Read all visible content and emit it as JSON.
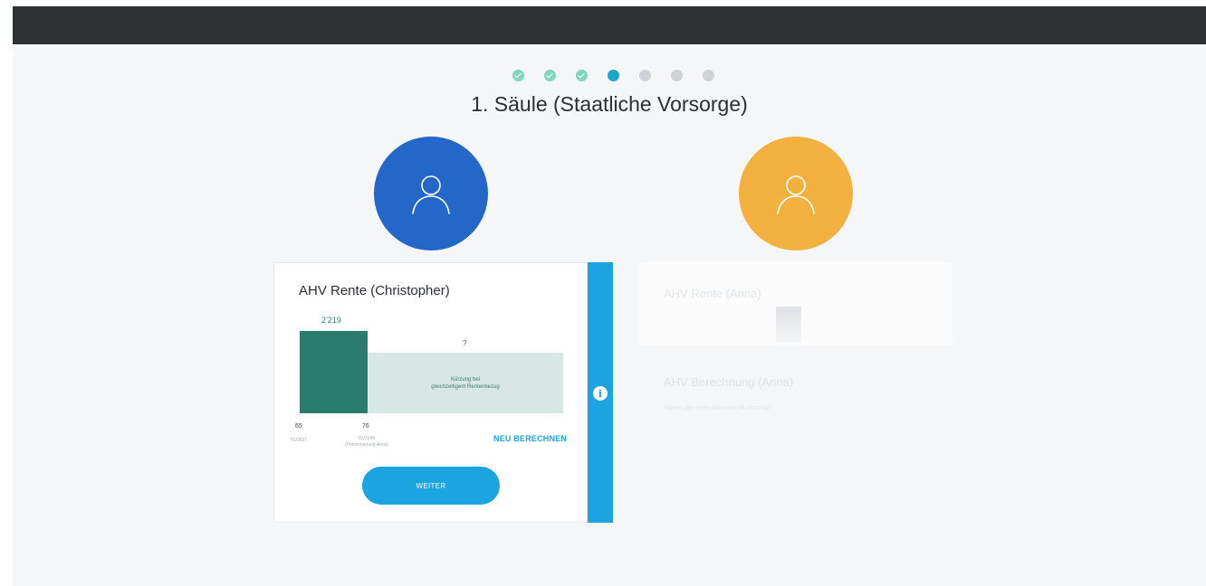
{
  "progress": {
    "total": 7,
    "current": 4,
    "steps": [
      "done",
      "done",
      "done",
      "active",
      "todo",
      "todo",
      "todo"
    ]
  },
  "page_title": "1. Säule (Staatliche Vorsorge)",
  "persons": [
    {
      "name": "Christopher",
      "avatar_color": "#2566c9",
      "icon": "user-icon"
    },
    {
      "name": "Anna",
      "avatar_color": "#f2b13f",
      "icon": "user-icon"
    }
  ],
  "card": {
    "title": "AHV Rente (Christopher)",
    "bar_value": "2'219",
    "reduced_value": "?",
    "reduced_note_1": "Kürzung bei",
    "reduced_note_2": "gleichzeitigem Rentenbezug",
    "tick1_age": "65",
    "tick1_date": "01/2037",
    "tick2_age": "76",
    "tick2_date": "01/2048",
    "tick2_note": "(Pensionierung Anna)",
    "recalc_label": "NEU BERECHNEN",
    "next_label": "WEITER",
    "info_icon": "info-icon",
    "accent_color": "#1ba4e0"
  },
  "faded_card": {
    "title": "AHV Rente (Anna)"
  },
  "calc_section": {
    "title": "AHV Berechnung (Anna)",
    "subtitle": "Haben Sie einen aktuellen IK-Auszug?"
  }
}
